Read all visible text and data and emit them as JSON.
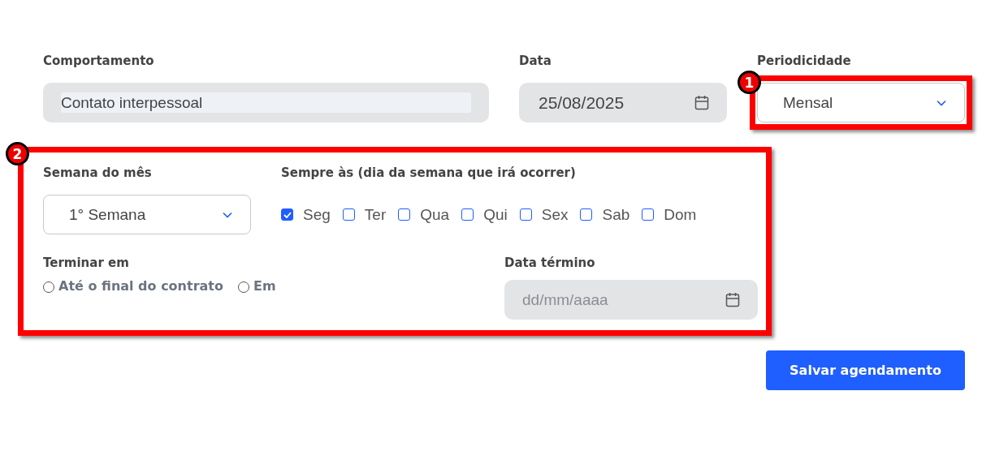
{
  "fields": [
    {
      "kind": "text",
      "label": "Comportamento",
      "value": "Contato interpessoal"
    },
    {
      "kind": "date",
      "label": "Data",
      "value": "25/08/2025"
    },
    {
      "kind": "select",
      "label": "Periodicidade",
      "value": "Mensal",
      "callout": "1"
    }
  ],
  "recurrence": {
    "callout": "2",
    "week_of_month": {
      "label": "Semana do mês",
      "value": "1° Semana"
    },
    "weekdays": {
      "label": "Sempre às (dia da semana que irá ocorrer)",
      "days": [
        {
          "label": "Seg",
          "checked": true
        },
        {
          "label": "Ter",
          "checked": false
        },
        {
          "label": "Qua",
          "checked": false
        },
        {
          "label": "Qui",
          "checked": false
        },
        {
          "label": "Sex",
          "checked": false
        },
        {
          "label": "Sab",
          "checked": false
        },
        {
          "label": "Dom",
          "checked": false
        }
      ]
    },
    "end": {
      "label": "Terminar em",
      "options": [
        {
          "label": "Até o final do contrato",
          "selected": false
        },
        {
          "label": "Em",
          "selected": false
        }
      ]
    },
    "end_date": {
      "label": "Data término",
      "placeholder": "dd/mm/aaaa"
    }
  },
  "save_button": "Salvar agendamento"
}
